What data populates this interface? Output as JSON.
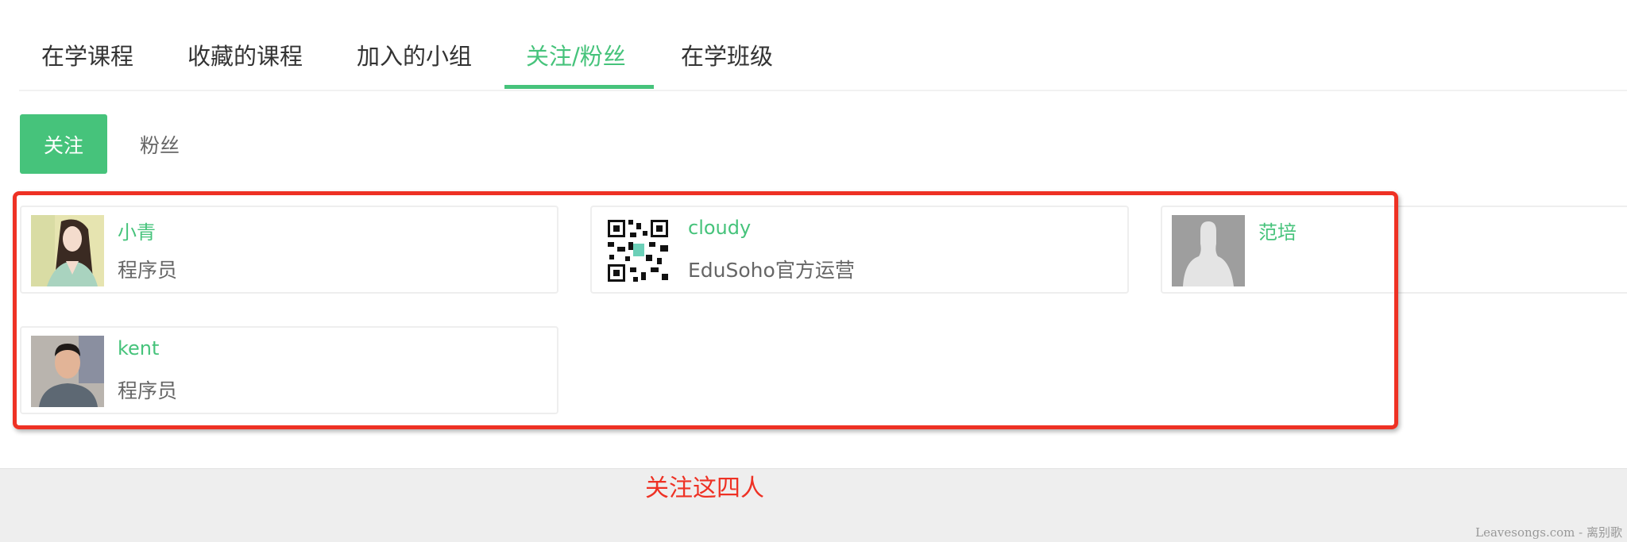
{
  "tabs": [
    {
      "label": "在学课程",
      "active": false
    },
    {
      "label": "收藏的课程",
      "active": false
    },
    {
      "label": "加入的小组",
      "active": false
    },
    {
      "label": "关注/粉丝",
      "active": true
    },
    {
      "label": "在学班级",
      "active": false
    }
  ],
  "subtabs": {
    "following": "关注",
    "fans": "粉丝",
    "active": "following"
  },
  "users": [
    {
      "name": "小青",
      "title": "程序员",
      "avatar": "illustrated-girl-avatar"
    },
    {
      "name": "cloudy",
      "title": "EduSoho官方运营",
      "avatar": "qr-code-avatar"
    },
    {
      "name": "范培",
      "title": "",
      "avatar": "default-silhouette-avatar"
    },
    {
      "name": "kent",
      "title": "程序员",
      "avatar": "man-photo-avatar"
    }
  ],
  "annotation": "关注这四人",
  "watermark": "Leavesongs.com - 离别歌",
  "colors": {
    "accent": "#46c37b",
    "annotation": "#ee3124",
    "footer": "#eeeeee"
  }
}
